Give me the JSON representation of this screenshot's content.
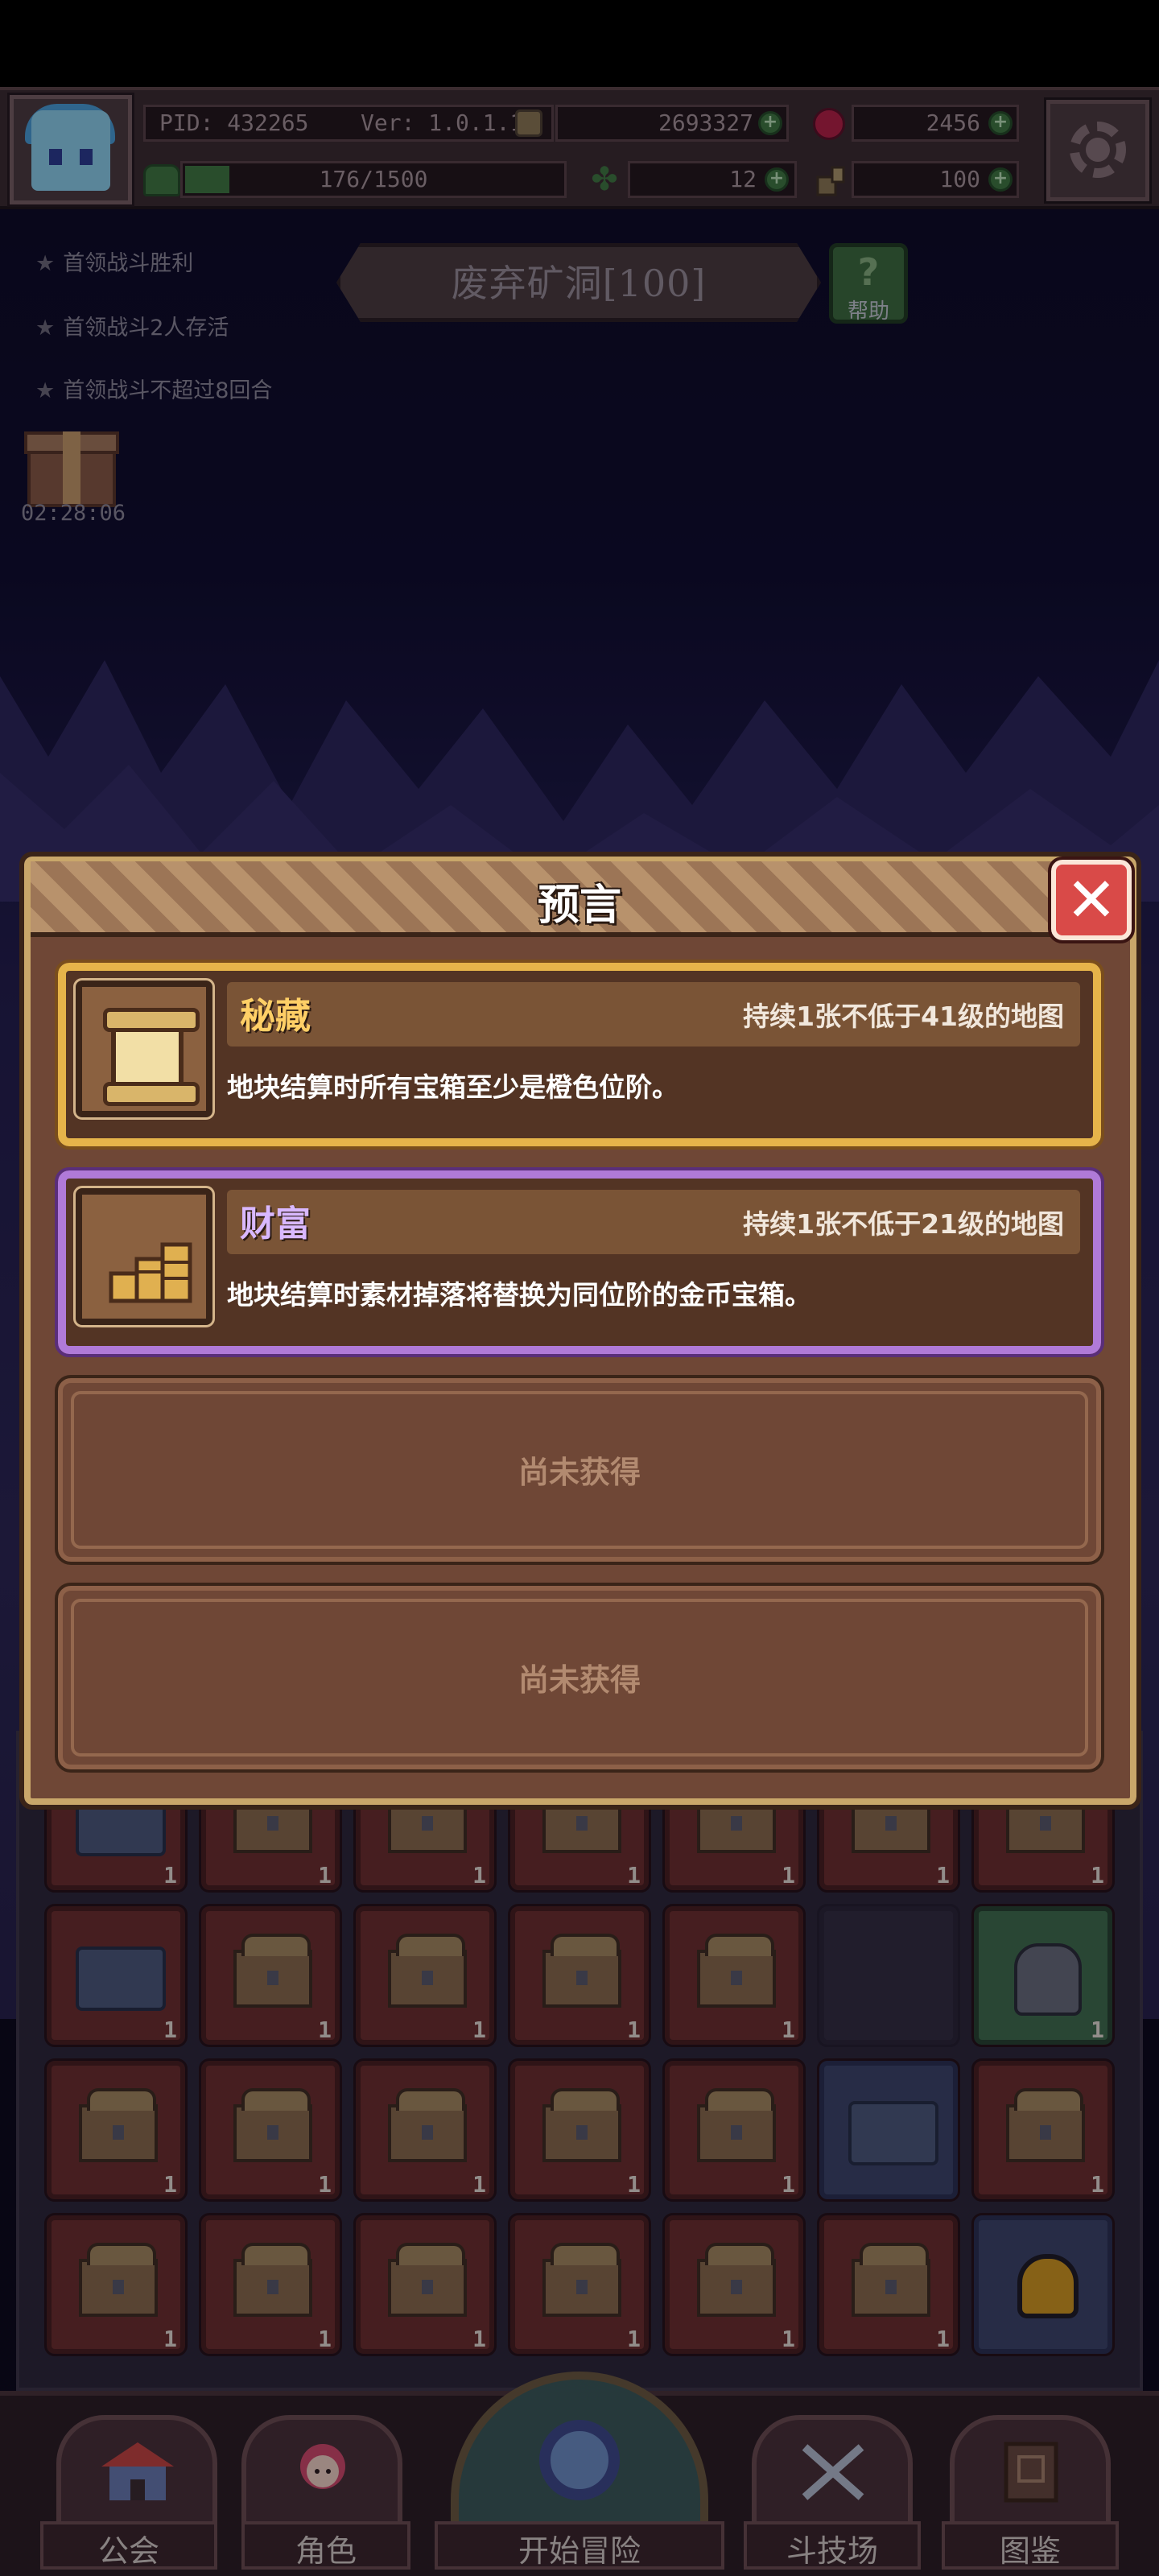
{
  "status": {
    "pid": "PID: 432265",
    "version": "Ver: 1.0.1.1",
    "gold": "2693327",
    "gems": "2456",
    "exp": "176/1500",
    "exp_fraction": 0.117,
    "stamina": "12",
    "keys": "100",
    "plus_icon": "+"
  },
  "quests": [
    {
      "text": "首领战斗胜利"
    },
    {
      "text": "首领战斗2人存活"
    },
    {
      "text": "首领战斗不超过8回合"
    }
  ],
  "quest_star": "★",
  "gift": {
    "timer": "02:28:06"
  },
  "map": {
    "name": "废弃矿洞[100]",
    "help_label": "帮助",
    "help_glyph": "?"
  },
  "dialog": {
    "title": "预言",
    "close_glyph": "✕",
    "cards": [
      {
        "name": "秘藏",
        "duration": "持续1张不低于41级的地图",
        "desc": "地块结算时所有宝箱至少是橙色位阶。",
        "rarity": "gold",
        "icon": "scroll-icon"
      },
      {
        "name": "财富",
        "duration": "持续1张不低于21级的地图",
        "desc": "地块结算时素材掉落将替换为同位阶的金币宝箱。",
        "rarity": "purple",
        "icon": "coins-icon"
      }
    ],
    "empty_slots": [
      {
        "label": "尚未获得"
      },
      {
        "label": "尚未获得"
      }
    ]
  },
  "inventory": {
    "rows": [
      [
        "chest-blue",
        "chest",
        "chest",
        "chest",
        "chest",
        "chest",
        "chest"
      ],
      [
        "device",
        "chest",
        "chest",
        "chest",
        "chest",
        "empty",
        "armor"
      ],
      [
        "chest",
        "chest",
        "chest",
        "chest",
        "chest",
        "device-blue",
        "chest"
      ],
      [
        "chest",
        "chest",
        "chest",
        "chest",
        "chest",
        "chest",
        "pot"
      ]
    ],
    "count_label": "1"
  },
  "nav": {
    "guild": "公会",
    "role": "角色",
    "start": "开始冒险",
    "arena": "斗技场",
    "codex": "图鉴"
  },
  "colors": {
    "gold_frame": "#e6b44a",
    "purple_frame": "#b07ad8",
    "close_red": "#d94a48",
    "dialog_brown": "#6f4736"
  }
}
